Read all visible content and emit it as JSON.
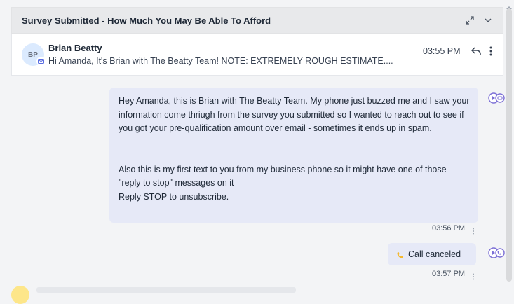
{
  "header": {
    "title": "Survey Submitted - How Much You May Be Able To Afford"
  },
  "email": {
    "avatar_initials": "BP",
    "sender": "Brian Beatty",
    "preview": "Hi Amanda, It's Brian with The Beatty Team! NOTE: EXTREMELY ROUGH ESTIMATE....",
    "time": "03:55 PM"
  },
  "messages": [
    {
      "paragraph1": "Hey Amanda, this is Brian with The Beatty Team. My phone just buzzed me and I saw your information come thriugh from the survey you submitted so I wanted to reach out to see if you got your pre-qualification amount over email - sometimes it ends up in spam.",
      "paragraph2": "Also this is my first text to you from my business phone so it might have one of those \"reply to stop\" messages on it",
      "paragraph3": "Reply STOP to unsubscribe.",
      "time": "03:56 PM"
    },
    {
      "label": "Call canceled",
      "time": "03:57 PM"
    }
  ],
  "colors": {
    "bubble": "#e6e9f7",
    "accent": "#7c6fd6",
    "call_dot": "#f5b82e"
  },
  "icons": {
    "expand": "expand-icon",
    "collapse": "chevron-down-icon",
    "reply": "reply-icon",
    "more": "more-vertical-icon",
    "mail": "mail-icon",
    "channel": "message-channel-icon",
    "phone": "phone-channel-icon"
  }
}
